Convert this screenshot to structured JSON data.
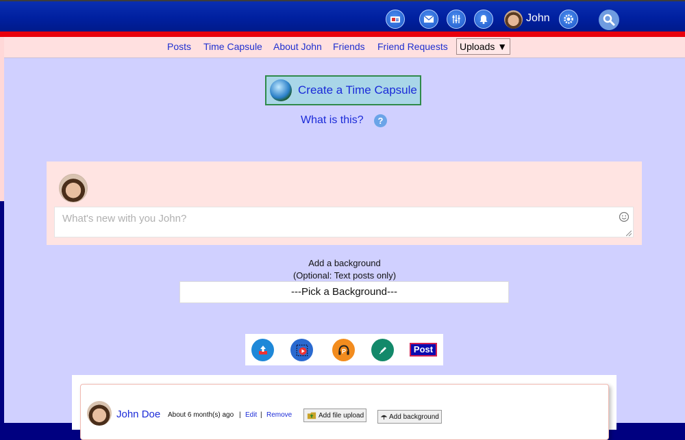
{
  "header": {
    "user_name": "John",
    "icons": [
      "id-card-icon",
      "mail-icon",
      "equalizer-icon",
      "bell-icon",
      "settings-gear-icon",
      "search-icon"
    ]
  },
  "tabs": [
    {
      "label": "Posts"
    },
    {
      "label": "Time Capsule"
    },
    {
      "label": "About John"
    },
    {
      "label": "Friends"
    },
    {
      "label": "Friend Requests"
    }
  ],
  "uploads_menu": {
    "label": "Uploads ▼"
  },
  "time_capsule": {
    "create_label": "Create a Time Capsule",
    "what_is_this": "What is this?",
    "help_glyph": "?"
  },
  "composer": {
    "placeholder": "What's new with you John?"
  },
  "background": {
    "title": "Add a background",
    "subtitle": "(Optional: Text posts only)",
    "select_label": "---Pick a Background---"
  },
  "post_tools": {
    "post_label": "Post"
  },
  "feed": {
    "author": "John Doe",
    "time": "About 6 month(s) ago",
    "sep": "|",
    "edit_label": "Edit",
    "remove_label": "Remove",
    "add_file_label": "Add file upload",
    "add_background_label": "Add background"
  }
}
